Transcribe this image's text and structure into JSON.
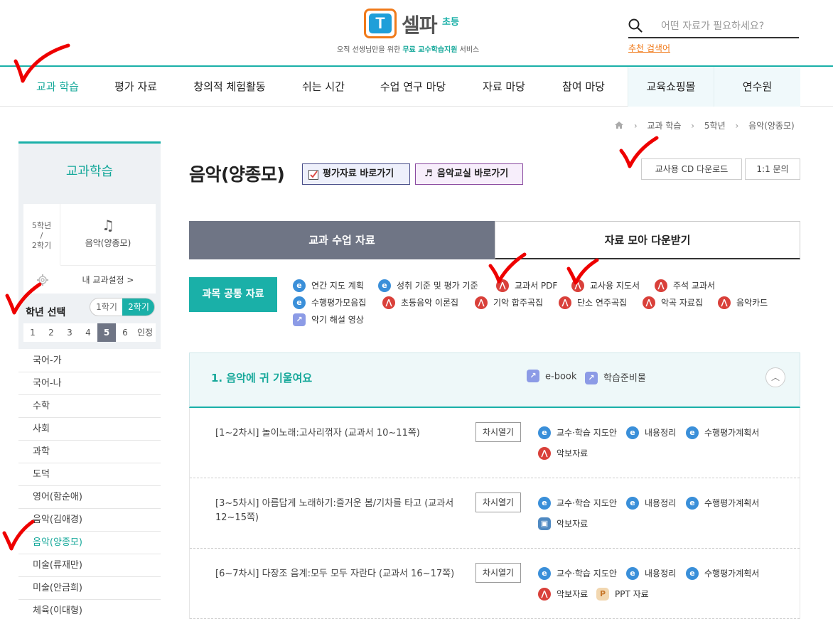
{
  "brand": {
    "logo_letter": "T",
    "name": "셀파",
    "sub": "초등",
    "tagline_pre": "오직 선생님만을 위한 ",
    "tagline_hl": "무료 교수학습지원",
    "tagline_post": " 서비스"
  },
  "search": {
    "placeholder": "어떤 자료가 필요하세요?",
    "recommend": "추천 검색어"
  },
  "nav": [
    "교과 학습",
    "평가 자료",
    "창의적 체험활동",
    "쉬는 시간",
    "수업 연구 마당",
    "자료 마당",
    "참여 마당",
    "교육쇼핑몰",
    "연수원"
  ],
  "breadcrumb": [
    "교과 학습",
    "5학년",
    "음악(양종모)"
  ],
  "sidebar": {
    "title": "교과학습",
    "grade_line1": "5학년",
    "grade_line2": "/",
    "grade_line3": "2학기",
    "subject": "음악(양종모)",
    "setting": "내 교과설정 >",
    "grade_select_label": "학년 선택",
    "semesters": [
      "1학기",
      "2학기"
    ],
    "grades": [
      "1",
      "2",
      "3",
      "4",
      "5",
      "6",
      "인정"
    ],
    "items": [
      "국어-가",
      "국어-나",
      "수학",
      "사회",
      "과학",
      "도덕",
      "영어(함순애)",
      "음악(김애경)",
      "음악(양종모)",
      "미술(류재만)",
      "미술(안금희)",
      "체육(이대형)"
    ]
  },
  "main": {
    "title": "음악(양종모)",
    "eval_btn": "평가자료 바로가기",
    "music_btn": "음악교실 바로가기",
    "cd_btn": "교사용 CD 다운로드",
    "qa_btn": "1:1 문의",
    "tab_a": "교과 수업 자료",
    "tab_b": "자료 모아 다운받기",
    "common_label": "과목 공통 자료",
    "common": [
      "연간 지도 계획",
      "성취 기준 및 평가 기준",
      "교과서 PDF",
      "교사용 지도서",
      "주석 교과서",
      "수행평가모음집",
      "초등음악 이론집",
      "기악 합주곡집",
      "단소 연주곡집",
      "악곡 자료집",
      "음악카드",
      "악기 해설 영상"
    ]
  },
  "unit": {
    "title": "1. 음악에 귀 기울여요",
    "ebook": "e-book",
    "prep": "학습준비물"
  },
  "lessons": [
    {
      "title": "[1~2차시] 놀이노래:고사리꺾자 (교과서 10~11쪽)",
      "btn": "차시열기",
      "res": [
        "교수·학습 지도안",
        "내용정리",
        "수행평가계획서",
        "악보자료"
      ]
    },
    {
      "title": "[3~5차시] 아름답게 노래하기:즐거운 봄/기차를 타고 (교과서12~15쪽)",
      "btn": "차시열기",
      "res": [
        "교수·학습 지도안",
        "내용정리",
        "수행평가계획서",
        "악보자료"
      ]
    },
    {
      "title": "[6~7차시] 다장조 음계:모두 모두 자란다 (교과서 16~17쪽)",
      "btn": "차시열기",
      "res": [
        "교수·학습 지도안",
        "내용정리",
        "수행평가계획서",
        "악보자료",
        "PPT 자료"
      ]
    }
  ],
  "colors": {
    "accent": "#1ab0a8",
    "tab_dark": "#6f7585",
    "pdf": "#d9403a",
    "e_icon": "#3a8fd9",
    "logo_orange": "#f07a1a"
  }
}
